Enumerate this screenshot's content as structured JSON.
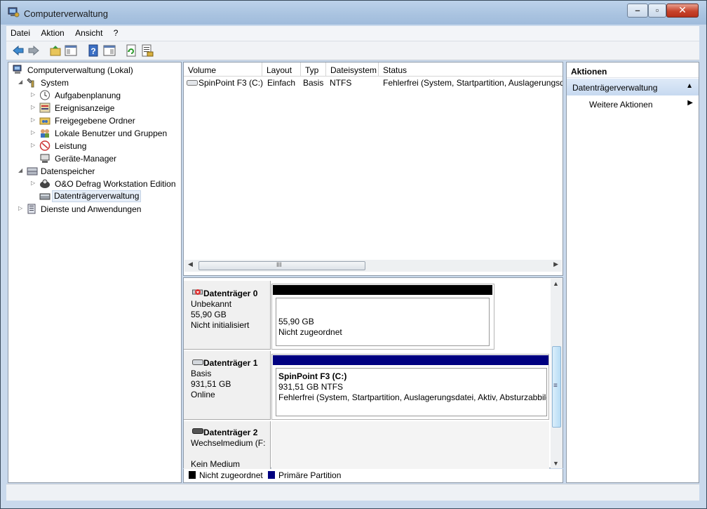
{
  "window": {
    "title": "Computerverwaltung"
  },
  "menu": [
    "Datei",
    "Aktion",
    "Ansicht",
    "?"
  ],
  "toolbar": {
    "icons": [
      "back-icon",
      "forward-icon",
      "up-folder-icon",
      "show-hide-tree-icon",
      "help-icon",
      "properties-icon",
      "refresh-icon",
      "export-list-icon"
    ]
  },
  "tree": {
    "root": "Computerverwaltung (Lokal)",
    "system": "System",
    "aufgaben": "Aufgabenplanung",
    "ereignis": "Ereignisanzeige",
    "freigegeben": "Freigegebene Ordner",
    "benutzer": "Lokale Benutzer und Gruppen",
    "leistung": "Leistung",
    "geraete": "Geräte-Manager",
    "datenspeicher": "Datenspeicher",
    "defrag": "O&O Defrag Workstation Edition",
    "datentraeger": "Datenträgerverwaltung",
    "dienste": "Dienste und Anwendungen"
  },
  "volumes": {
    "columns": [
      "Volume",
      "Layout",
      "Typ",
      "Dateisystem",
      "Status"
    ],
    "rows": [
      [
        "SpinPoint F3 (C:)",
        "Einfach",
        "Basis",
        "NTFS",
        "Fehlerfrei (System, Startpartition, Auslagerungsdatei"
      ]
    ],
    "scroll_thumb": "III"
  },
  "disks": [
    {
      "name": "Datenträger 0",
      "type": "Unbekannt",
      "size": "55,90 GB",
      "state": "Nicht initialisiert",
      "part_size": "55,90 GB",
      "part_state": "Nicht zugeordnet",
      "bar_color": "#000000"
    },
    {
      "name": "Datenträger 1",
      "type": "Basis",
      "size": "931,51 GB",
      "state": "Online",
      "part_name": "SpinPoint F3  (C:)",
      "part_size": "931,51 GB NTFS",
      "part_state": "Fehlerfrei (System, Startpartition, Auslagerungsdatei, Aktiv, Absturzabbild",
      "bar_color": "#000080"
    },
    {
      "name": "Datenträger 2",
      "type": "Wechselmedium (F:",
      "state": "Kein Medium"
    }
  ],
  "legend": [
    {
      "label": "Nicht zugeordnet",
      "color": "#000000"
    },
    {
      "label": "Primäre Partition",
      "color": "#000080"
    }
  ],
  "actions": {
    "header": "Aktionen",
    "section": "Datenträgerverwaltung",
    "more": "Weitere Aktionen"
  },
  "scroll_glyph": "≡"
}
